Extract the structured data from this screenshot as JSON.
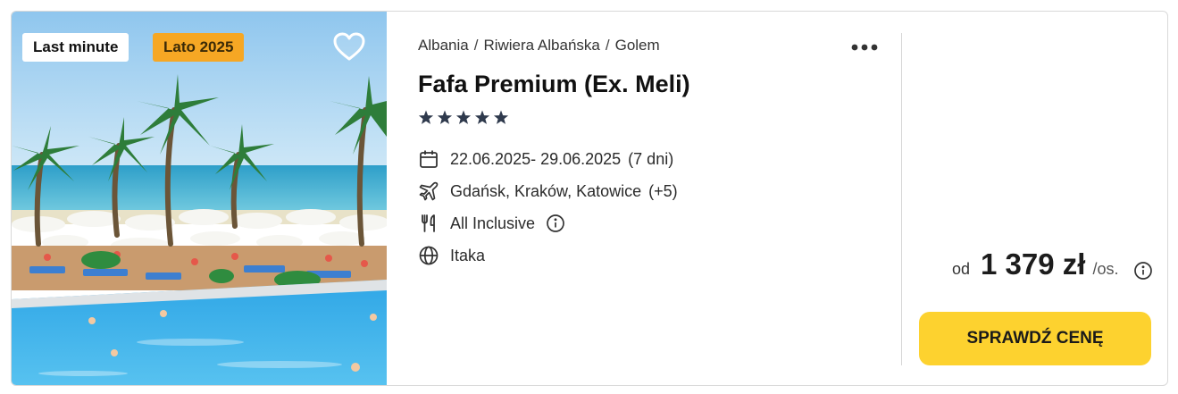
{
  "badges": {
    "last_minute": "Last minute",
    "season": "Lato 2025"
  },
  "icons": {
    "favorite": "heart-outline-icon",
    "more": "more-dots-icon",
    "date": "calendar-icon",
    "flight": "plane-icon",
    "board": "fork-knife-icon",
    "board_info": "info-circle-icon",
    "operator": "globe-icon",
    "price_info": "info-circle-icon"
  },
  "breadcrumb": [
    "Albania",
    "Riwiera Albańska",
    "Golem"
  ],
  "hotel": {
    "name": "Fafa Premium (Ex. Meli)",
    "stars": 5
  },
  "details": {
    "dates": "22.06.2025- 29.06.2025",
    "duration": "(7 dni)",
    "departures": "Gdańsk, Kraków, Katowice",
    "departures_more": "(+5)",
    "board": "All Inclusive",
    "operator": "Itaka"
  },
  "price": {
    "from_label": "od",
    "amount": "1 379 zł",
    "per_label": "/os."
  },
  "cta": {
    "label": "SPRAWDŹ CENĘ"
  },
  "colors": {
    "badge_season_bg": "#f6a724",
    "cta_bg": "#fdd22f",
    "star": "#2f3a4d"
  }
}
